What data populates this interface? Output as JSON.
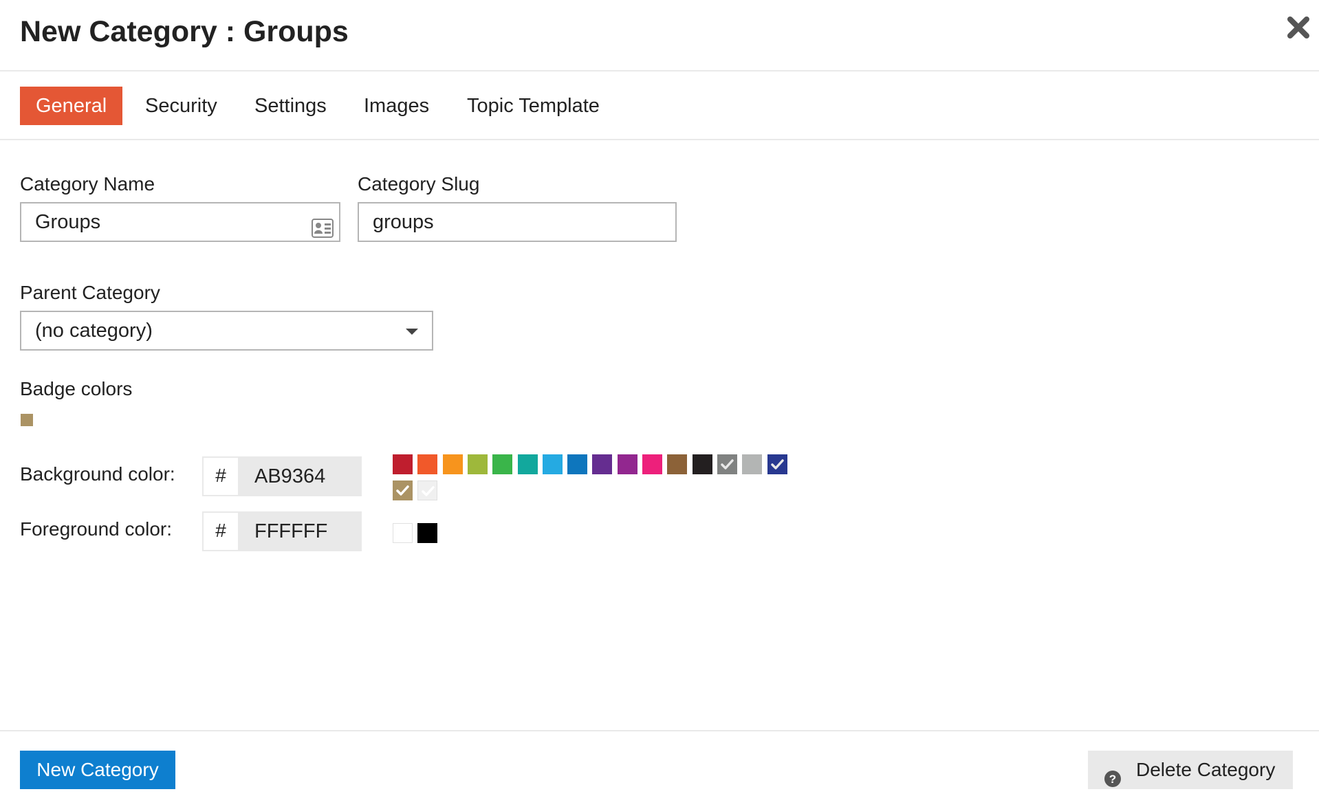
{
  "modal": {
    "title": "New Category : Groups",
    "close_icon": "close-icon"
  },
  "tabs": [
    {
      "label": "General",
      "active": true
    },
    {
      "label": "Security",
      "active": false
    },
    {
      "label": "Settings",
      "active": false
    },
    {
      "label": "Images",
      "active": false
    },
    {
      "label": "Topic Template",
      "active": false
    }
  ],
  "form": {
    "category_name": {
      "label": "Category Name",
      "value": "Groups",
      "icon": "contact-card-icon"
    },
    "category_slug": {
      "label": "Category Slug",
      "value": "groups"
    },
    "parent_category": {
      "label": "Parent Category",
      "selected": "(no category)",
      "icon": "caret-down-icon"
    },
    "badge_colors": {
      "label": "Badge colors",
      "preview_color": "#AB9364"
    },
    "background_color": {
      "label": "Background color:",
      "hash": "#",
      "value": "AB9364",
      "swatches": [
        {
          "color": "#BF1E2E",
          "selected": false
        },
        {
          "color": "#F1592A",
          "selected": false
        },
        {
          "color": "#F7941D",
          "selected": false
        },
        {
          "color": "#9EB83B",
          "selected": false
        },
        {
          "color": "#3AB54A",
          "selected": false
        },
        {
          "color": "#12A89D",
          "selected": false
        },
        {
          "color": "#25AAE2",
          "selected": false
        },
        {
          "color": "#0E76BD",
          "selected": false
        },
        {
          "color": "#652D90",
          "selected": false
        },
        {
          "color": "#92278F",
          "selected": false
        },
        {
          "color": "#ED207B",
          "selected": false
        },
        {
          "color": "#8C6238",
          "selected": false
        },
        {
          "color": "#231F20",
          "selected": false
        },
        {
          "color": "#808281",
          "selected": false,
          "used": true
        },
        {
          "color": "#B3B5B4",
          "selected": false
        },
        {
          "color": "#283890",
          "selected": false,
          "used": true
        },
        {
          "color": "#AB9364",
          "selected": true
        },
        {
          "color": "#F0F0F0",
          "selected": false,
          "used": true
        }
      ]
    },
    "foreground_color": {
      "label": "Foreground color:",
      "hash": "#",
      "value": "FFFFFF",
      "swatches": [
        {
          "color": "#FFFFFF"
        },
        {
          "color": "#000000"
        }
      ]
    }
  },
  "footer": {
    "primary_label": "New Category",
    "delete_label": "Delete Category",
    "delete_icon": "question-circle-icon"
  },
  "colors": {
    "accent": "#E45735",
    "primary_button": "#0E7FCF",
    "border": "#B5B5B5",
    "divider": "#E9E9E9"
  }
}
